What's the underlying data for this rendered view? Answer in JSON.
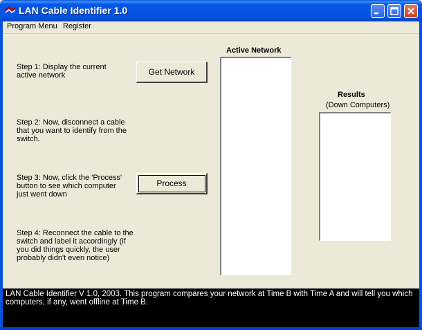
{
  "window": {
    "title": "LAN Cable Identifier 1.0",
    "icon": "cable-icon"
  },
  "menu": {
    "items": [
      "Program Menu",
      "Register"
    ]
  },
  "steps": {
    "step1": "Step 1:  Display the current active network",
    "step2": "Step 2:   Now, disconnect a cable that you want to identify from the switch.",
    "step3": "Step 3:  Now, click the 'Process' button to see which computer just went down",
    "step4": "Step 4:  Reconnect the cable to the switch and label it accordingly (if you did things quickly, the user probably didn't even notice)"
  },
  "buttons": {
    "get_network": "Get Network",
    "process": "Process"
  },
  "active_network": {
    "label": "Active Network",
    "items": []
  },
  "results": {
    "label": "Results",
    "sublabel": "(Down Computers)",
    "items": []
  },
  "status": {
    "text": "LAN Cable Identifier V 1.0, 2003.  This program compares your network at Time B with Time A and will tell you which computers, if any, went offline at Time B."
  },
  "colors": {
    "titlebar": "#0453e0",
    "window_bg": "#ece9d8",
    "status_bg": "#000000",
    "status_fg": "#ffffff"
  }
}
